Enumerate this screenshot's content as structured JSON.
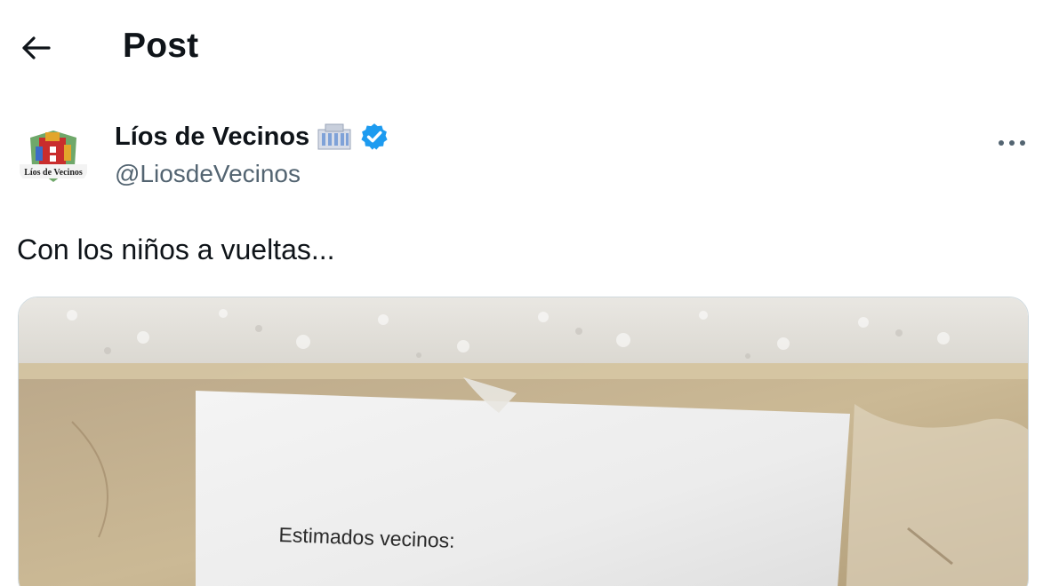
{
  "header": {
    "title": "Post",
    "back_icon": "arrow-left-icon"
  },
  "author": {
    "display_name": "Líos de Vecinos",
    "handle": "@LiosdeVecinos",
    "avatar_logo_text": "Líos de Vecinos",
    "emoji_icon": "office-building-icon",
    "verified_icon": "verified-badge-icon",
    "verified_color": "#1d9bf0"
  },
  "post": {
    "text": "Con los niños a vueltas...",
    "more_icon": "more-horizontal-icon",
    "media": {
      "note_text": "Estimados vecinos:"
    }
  },
  "colors": {
    "text_primary": "#0f1419",
    "text_secondary": "#536471",
    "border": "#cfd9de",
    "accent": "#1d9bf0"
  }
}
